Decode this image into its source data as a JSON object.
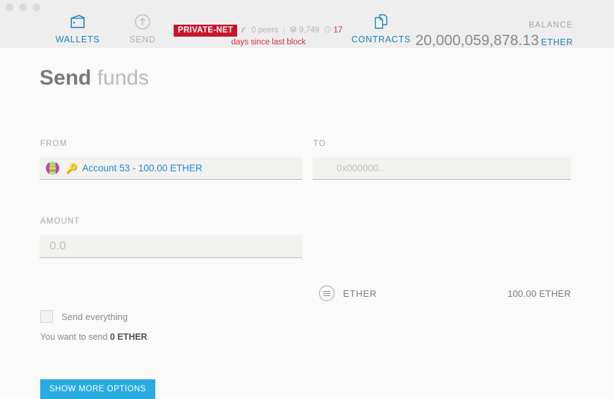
{
  "window": {
    "controls": [
      "close",
      "minimize",
      "maximize"
    ]
  },
  "nav": {
    "tabs": [
      {
        "id": "wallets",
        "label": "WALLETS",
        "icon": "wallet-icon",
        "active": false
      },
      {
        "id": "send",
        "label": "SEND",
        "icon": "arrow-up-circle-icon",
        "active": true
      },
      {
        "id": "contracts",
        "label": "CONTRACTS",
        "icon": "documents-icon",
        "active": false
      }
    ]
  },
  "network": {
    "badge": "PRIVATE-NET",
    "peers": "0 peers",
    "peers_icon": "signal-icon",
    "separator": "|",
    "block_number": "9,749",
    "block_icon": "cube-icon",
    "time_since": "17",
    "time_icon": "clock-icon",
    "time_caption": "days since last block",
    "badge_color": "#c5172b",
    "alert_color": "#d0333f"
  },
  "balance": {
    "label": "BALANCE",
    "value": "20,000,059,878.13",
    "unit": "ETHER",
    "unit_color": "#1f7fba"
  },
  "page": {
    "title_bold": "Send",
    "title_light": "funds"
  },
  "form": {
    "from": {
      "label": "FROM",
      "avatar": "identicon-avatar",
      "key_icon": "key-icon",
      "value": "Account 53 - 100.00 ETHER",
      "value_color": "#1f88d0"
    },
    "to": {
      "label": "TO",
      "placeholder": "0x000000..",
      "value": ""
    },
    "amount": {
      "label": "AMOUNT",
      "placeholder": "0.0",
      "value": ""
    },
    "unit_selector": {
      "icon": "unit-list-icon",
      "unit": "ETHER",
      "available_total": "100.00 ETHER"
    },
    "send_everything": {
      "label": "Send everything",
      "checked": false
    },
    "note_prefix": "You want to send ",
    "note_amount": "0 ETHER",
    "note_suffix": ".",
    "submit_button": "SHOW MORE OPTIONS",
    "submit_button_color": "#29abe2"
  }
}
